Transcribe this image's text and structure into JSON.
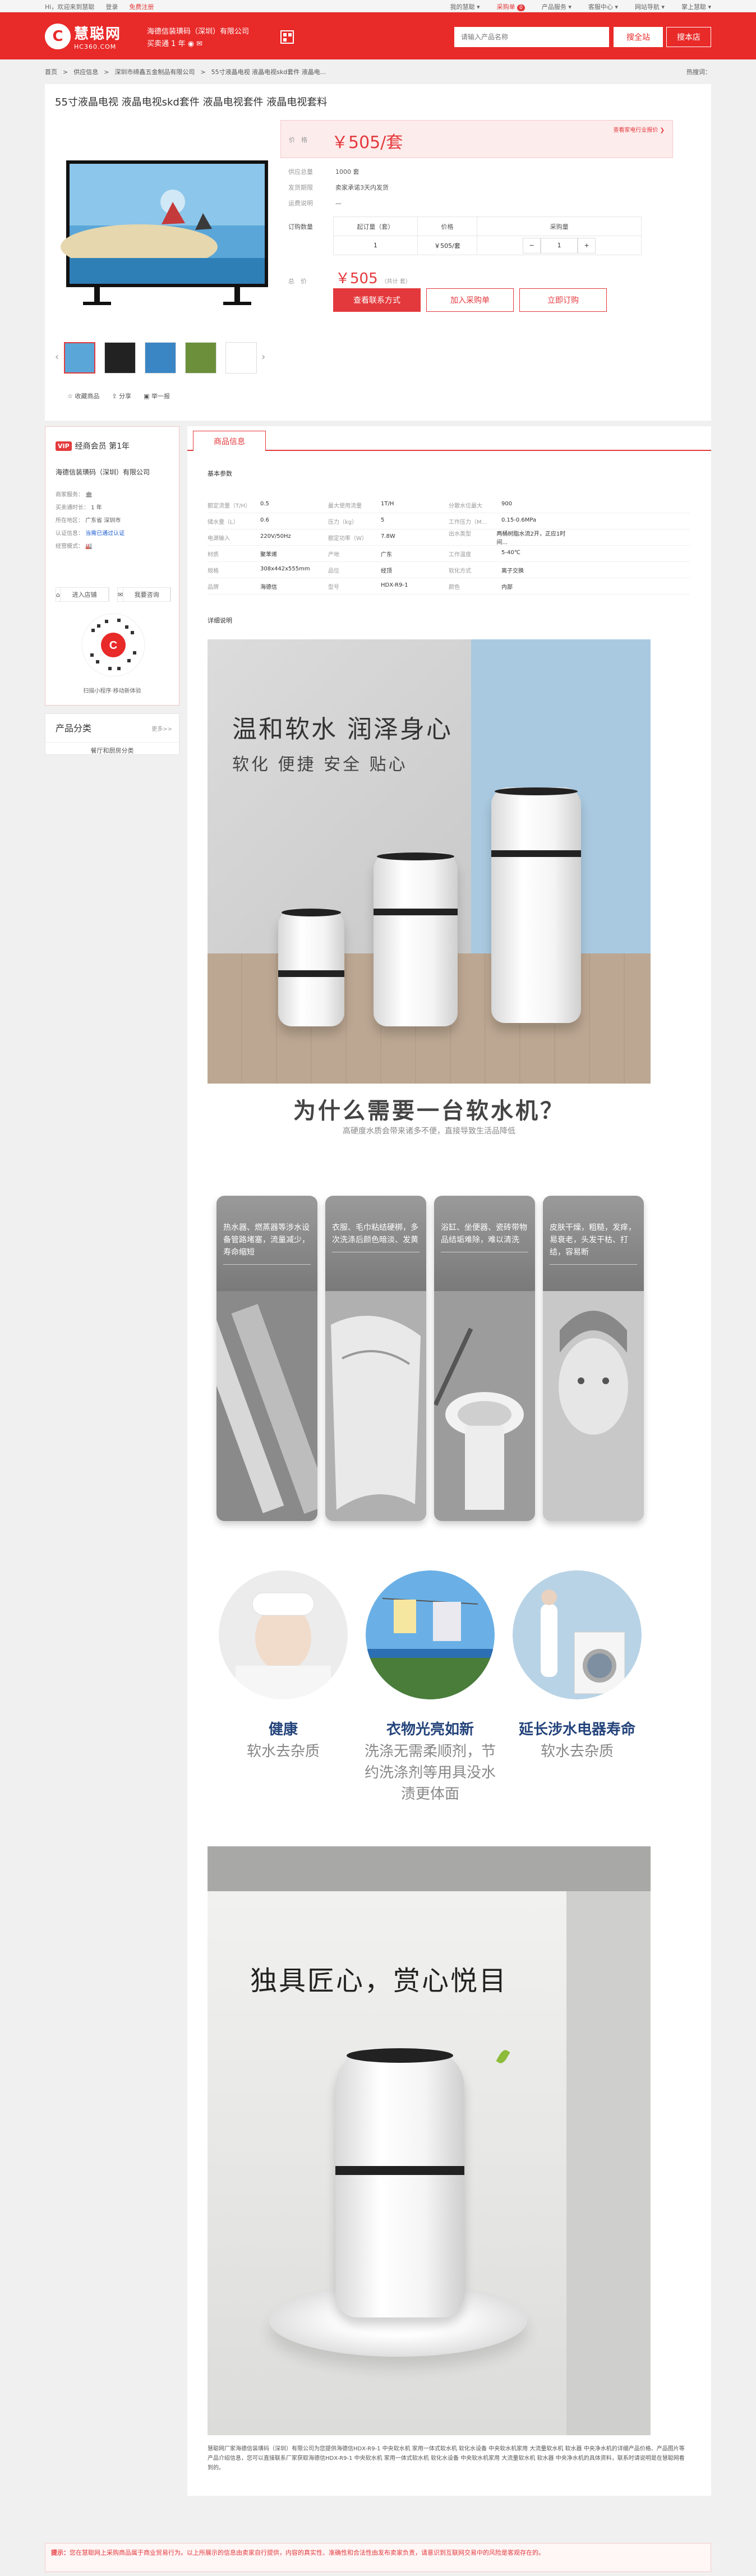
{
  "topbar": {
    "greeting": "Hi，欢迎来到慧聪",
    "login": "登录",
    "register": "免费注册",
    "links": [
      {
        "label": "我的慧聪",
        "badge": ""
      },
      {
        "label": "采购单",
        "badge": "0"
      },
      {
        "label": "产品服务",
        "badge": ""
      },
      {
        "label": "客服中心",
        "badge": ""
      },
      {
        "label": "网站导航",
        "badge": ""
      },
      {
        "label": "掌上慧聪",
        "badge": ""
      }
    ]
  },
  "header": {
    "logo_cn": "慧聪网",
    "logo_en": "HC360.COM",
    "shop_name": "海德信装璜码（深圳）有限公司",
    "shop_years": "买卖通 1 年",
    "search_placeholder": "请输入产品名称",
    "search_button": "搜全站",
    "shop_search_button": "搜本店"
  },
  "breadcrumb": {
    "items": [
      "首页",
      "供应信息",
      "深圳市缔鑫五金制品有限公司",
      "55寸液晶电视 液晶电视skd套件 液晶电..."
    ],
    "hot": "热搜词："
  },
  "product": {
    "title": "55寸液晶电视 液晶电视skd套件 液晶电视套件 液晶电视套料",
    "price_label": "价　格",
    "price": "￥505/套",
    "related_link": "查看家电行业报价 ❯",
    "details": [
      {
        "k": "供应总量",
        "v": "1000 套"
      },
      {
        "k": "发货期限",
        "v": "卖家承诺3天内发货"
      },
      {
        "k": "运费说明",
        "v": "—"
      }
    ],
    "order_label": "订购数量",
    "spec_headers": [
      "起订量（套）",
      "价格",
      "采购量"
    ],
    "spec_row": {
      "min": "1",
      "price": "￥505/套",
      "qty": "1"
    },
    "total_label": "总　价",
    "total": "￥505",
    "total_unit": "（共计 套）",
    "btn_contact": "查看联系方式",
    "btn_cart": "加入采购单",
    "btn_buy": "立即订购",
    "actions": [
      "收藏商品",
      "分享",
      "举一报"
    ]
  },
  "member": {
    "badge": "VIP",
    "level": "经商会员  第1年",
    "company": "海德信装璜码（深圳）有限公司",
    "rows": [
      {
        "k": "商家服务：",
        "v": "🏛"
      },
      {
        "k": "买卖通时长：",
        "v": "1 年"
      },
      {
        "k": "所在地区：",
        "v": "广东省 深圳市"
      },
      {
        "k": "认证信息：",
        "v": "当需已通过认证"
      },
      {
        "k": "经营模式：",
        "v": "🏭"
      }
    ],
    "btn_shop": "进入店铺",
    "btn_chat": "我要咨询",
    "qr_caption": "扫描小程序·移动新体验"
  },
  "category": {
    "title": "产品分类",
    "more": "更多>>",
    "item": "餐厅和厨房分类"
  },
  "detail": {
    "tab": "商品信息",
    "basic_title": "基本参数",
    "params": [
      [
        [
          "额定流量（T/H）",
          "0.5"
        ],
        [
          "最大使用流量",
          "1T/H"
        ],
        [
          "分散水位最大",
          "900"
        ]
      ],
      [
        [
          "储水量（L）",
          "0.6"
        ],
        [
          "压力（kg）",
          "5"
        ],
        [
          "工作压力（M...",
          "0.15-0.6MPa"
        ]
      ],
      [
        [
          "电源输入",
          "220V/50Hz"
        ],
        [
          "额定功率（W）",
          "7.8W"
        ],
        [
          "出水类型",
          "两桶树脂水流2开，正应1时间..."
        ]
      ],
      [
        [
          "材质",
          "聚苯烯"
        ],
        [
          "产地",
          "广东"
        ],
        [
          "工作温度",
          "5-40℃"
        ]
      ],
      [
        [
          "规格",
          "308x442x555mm"
        ],
        [
          "品位",
          "经顶"
        ],
        [
          "软化方式",
          "离子交换"
        ]
      ],
      [
        [
          "品牌",
          "海德信"
        ],
        [
          "型号",
          "HDX-R9-1"
        ],
        [
          "颜色",
          "内部"
        ]
      ]
    ],
    "detail_title": "详细说明",
    "poster1_title": "温和软水 润泽身心",
    "poster1_sub": "软化 便捷 安全 贴心",
    "why_title": "为什么需要一台软水机？",
    "why_sub": "高硬度水质会带来诸多不便，直接导致生活品降低",
    "cards": [
      "热水器、燃蒸器等涉水设备管路堵塞，流量减少，寿命缩短",
      "衣服、毛巾粘结硬梆，多次洗涤后颜色暗淡、发黄",
      "浴缸、坐便器、瓷砖带物品结垢难除，难以清洗",
      "皮肤干燥，粗糙，发痒，易衰老，头发干枯、打结，容易断"
    ],
    "benefits": [
      {
        "t1": "健康",
        "t2": "软水去杂质"
      },
      {
        "t1": "衣物光亮如新",
        "t2": "洗涤无需柔顺剂，节约洗涤剂等用具没水渍更体面"
      },
      {
        "t1": "延长涉水电器寿命",
        "t2": "软水去杂质"
      }
    ],
    "poster2_title": "独具匠心，赏心悦目",
    "description": "慧聪网厂家海德信装璜码（深圳）有限公司为您提供海德信HDX-R9-1 中央软水机 家用一体式软水机 软化水设备 中央软水机家用 大流量软水机 软水器 中央净水机的详细产品价格、产品图片等产品介绍信息，您可以直接联系厂家获取海德信HDX-R9-1 中央软水机 家用一体式软水机 软化水设备 中央软水机家用 大流量软水机 软水器 中央净水机的具体资料，联系时请说明是在慧聪网看到的。"
  },
  "notice": {
    "label": "提示：",
    "text": "您在慧聪网上采购商品属于商业贸易行为。以上所展示的信息由卖家自行提供，内容的真实性、准确性和合法性由发布卖家负责，请意识到互联网交易中的风险是客观存在的。"
  },
  "colors": {
    "brand": "#e82a29",
    "accent": "#e4393c",
    "benefit": "#23437a"
  }
}
